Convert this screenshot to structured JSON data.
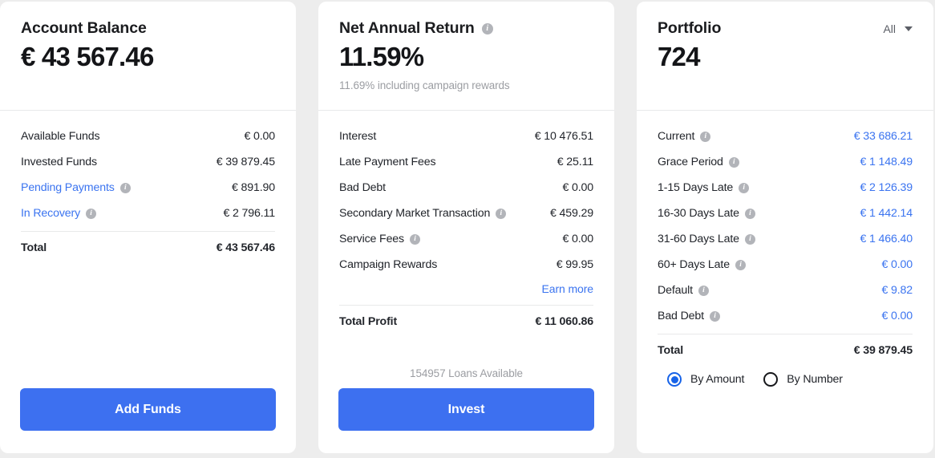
{
  "theme": {
    "page_background": "#ededed",
    "card_background": "#ffffff",
    "accent_blue": "#3d70f0",
    "link_blue": "#3b74f0",
    "text_primary": "#22252b",
    "text_muted": "#9b9da2"
  },
  "account_balance": {
    "title": "Account Balance",
    "amount": "€ 43 567.46",
    "rows": [
      {
        "label": "Available Funds",
        "value": "€ 0.00",
        "label_link": false,
        "info": false,
        "value_blue": false
      },
      {
        "label": "Invested Funds",
        "value": "€ 39 879.45",
        "label_link": false,
        "info": false,
        "value_blue": false
      },
      {
        "label": "Pending Payments",
        "value": "€ 891.90",
        "label_link": true,
        "info": true,
        "value_blue": false
      },
      {
        "label": "In Recovery",
        "value": "€ 2 796.11",
        "label_link": true,
        "info": true,
        "value_blue": false
      }
    ],
    "total_label": "Total",
    "total_value": "€ 43 567.46",
    "button_label": "Add Funds"
  },
  "net_annual_return": {
    "title": "Net Annual Return",
    "title_info": "info-icon",
    "percent": "11.59%",
    "subtitle": "11.69% including campaign rewards",
    "rows": [
      {
        "label": "Interest",
        "value": "€ 10 476.51",
        "info": false
      },
      {
        "label": "Late Payment Fees",
        "value": "€ 25.11",
        "info": false
      },
      {
        "label": "Bad Debt",
        "value": "€ 0.00",
        "info": false
      },
      {
        "label": "Secondary Market Transaction",
        "value": "€ 459.29",
        "info": true
      },
      {
        "label": "Service Fees",
        "value": "€ 0.00",
        "info": true
      },
      {
        "label": "Campaign Rewards",
        "value": "€ 99.95",
        "info": false
      }
    ],
    "earn_more_label": "Earn more",
    "total_label": "Total Profit",
    "total_value": "€ 11 060.86",
    "loans_available": "154957 Loans Available",
    "button_label": "Invest"
  },
  "portfolio": {
    "title": "Portfolio",
    "count": "724",
    "filter_value": "All",
    "rows": [
      {
        "label": "Current",
        "value": "€ 33 686.21",
        "info": true
      },
      {
        "label": "Grace Period",
        "value": "€ 1 148.49",
        "info": true
      },
      {
        "label": "1-15 Days Late",
        "value": "€ 2 126.39",
        "info": true
      },
      {
        "label": "16-30 Days Late",
        "value": "€ 1 442.14",
        "info": true
      },
      {
        "label": "31-60 Days Late",
        "value": "€ 1 466.40",
        "info": true
      },
      {
        "label": "60+ Days Late",
        "value": "€ 0.00",
        "info": true
      },
      {
        "label": "Default",
        "value": "€ 9.82",
        "info": true
      },
      {
        "label": "Bad Debt",
        "value": "€ 0.00",
        "info": true
      }
    ],
    "total_label": "Total",
    "total_value": "€ 39 879.45",
    "radios": [
      {
        "label": "By Amount",
        "selected": true
      },
      {
        "label": "By Number",
        "selected": false
      }
    ]
  }
}
